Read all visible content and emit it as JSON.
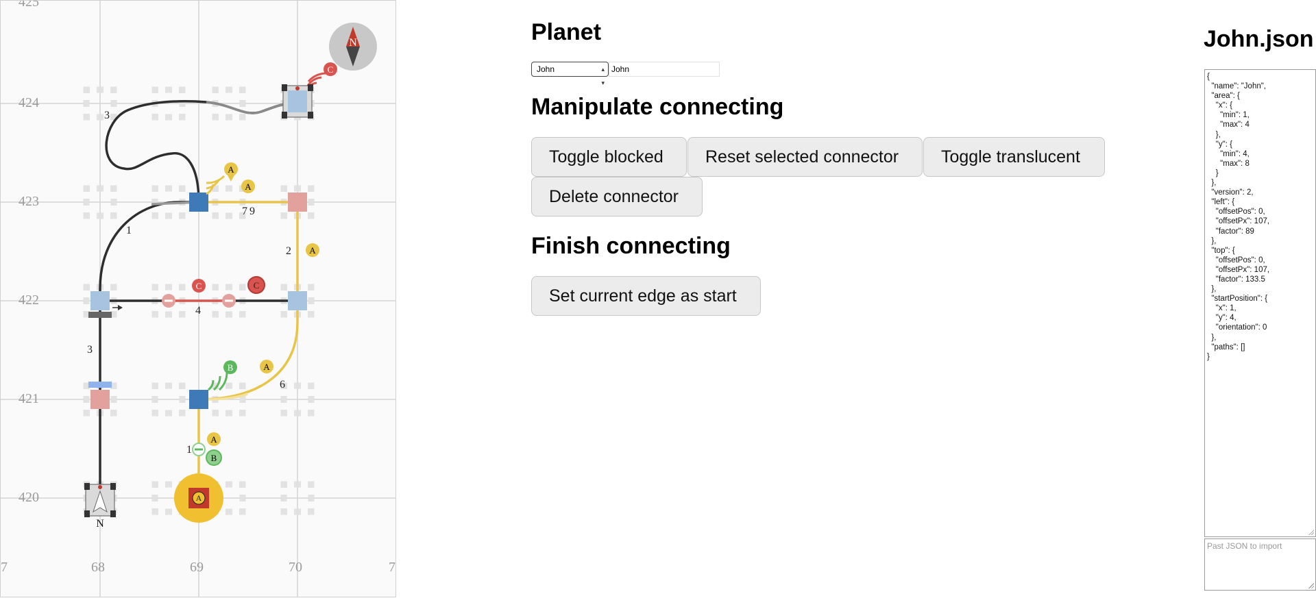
{
  "map": {
    "y_axis_labels": [
      "425",
      "424",
      "423",
      "422",
      "421",
      "420"
    ],
    "x_axis_labels": [
      "7",
      "68",
      "69",
      "70",
      "7"
    ],
    "compass_label": "N",
    "robot_label": "N",
    "path_weights": [
      "3",
      "1",
      "7",
      "9",
      "2",
      "4",
      "3",
      "6",
      "1"
    ],
    "markers": {
      "A": "A",
      "B": "B",
      "C": "C"
    },
    "colors": {
      "dark_path": "#2e2e2e",
      "yellow_path": "#e8c547",
      "red_path": "#d9534f",
      "blue_node": "#3f7ab8",
      "light_blue_node": "#a6c4e0",
      "pink_node": "#e3a19d",
      "green": "#5cb85c",
      "target_yellow": "#f0c030"
    }
  },
  "planet": {
    "title": "Planet",
    "selected": "John",
    "name_value": "John"
  },
  "manipulate": {
    "title": "Manipulate connecting",
    "toggle_blocked": "Toggle blocked",
    "reset_selected": "Reset selected connector",
    "toggle_translucent": "Toggle translucent",
    "delete_connector": "Delete connector"
  },
  "finish": {
    "title": "Finish connecting",
    "set_start": "Set current edge as start"
  },
  "json_panel": {
    "title": "John.json",
    "content": "{\n  \"name\": \"John\",\n  \"area\": {\n    \"x\": {\n      \"min\": 1,\n      \"max\": 4\n    },\n    \"y\": {\n      \"min\": 4,\n      \"max\": 8\n    }\n  },\n  \"version\": 2,\n  \"left\": {\n    \"offsetPos\": 0,\n    \"offsetPx\": 107,\n    \"factor\": 89\n  },\n  \"top\": {\n    \"offsetPos\": 0,\n    \"offsetPx\": 107,\n    \"factor\": 133.5\n  },\n  \"startPosition\": {\n    \"x\": 1,\n    \"y\": 4,\n    \"orientation\": 0\n  },\n  \"paths\": []\n}",
    "import_placeholder": "Past JSON to import"
  }
}
